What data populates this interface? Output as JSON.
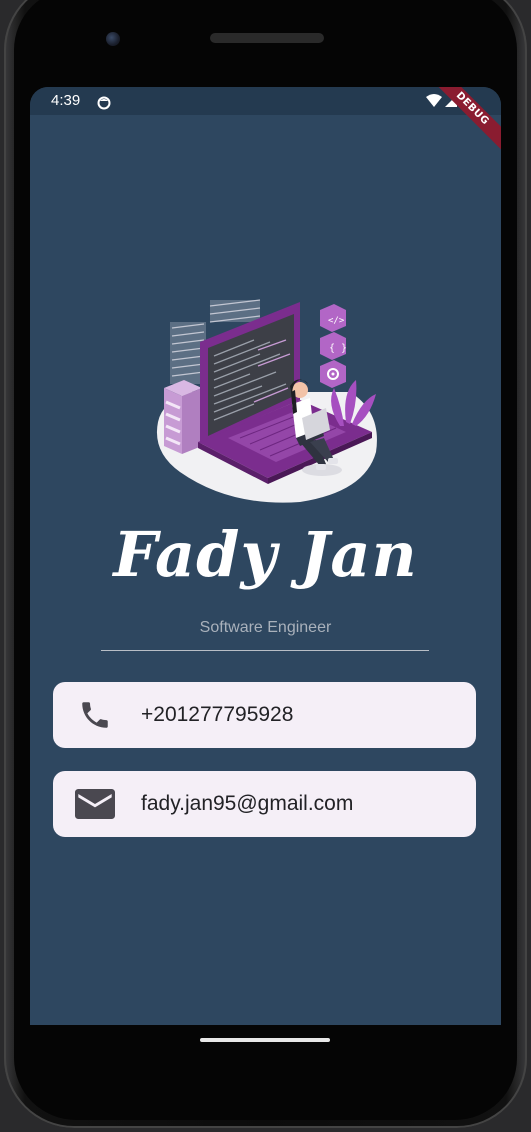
{
  "status_bar": {
    "time": "4:39",
    "debug_banner": "DEBUG"
  },
  "profile": {
    "name": "Fady Jan",
    "title": "Software Engineer"
  },
  "contacts": {
    "phone": {
      "icon": "phone-icon",
      "value": "+201277795928"
    },
    "email": {
      "icon": "email-icon",
      "value": "fady.jan95@gmail.com"
    }
  },
  "colors": {
    "background": "#2e4760",
    "card": "#f5eff7",
    "accent_purple": "#7b2d8e",
    "debug_banner": "#8a1c30"
  }
}
